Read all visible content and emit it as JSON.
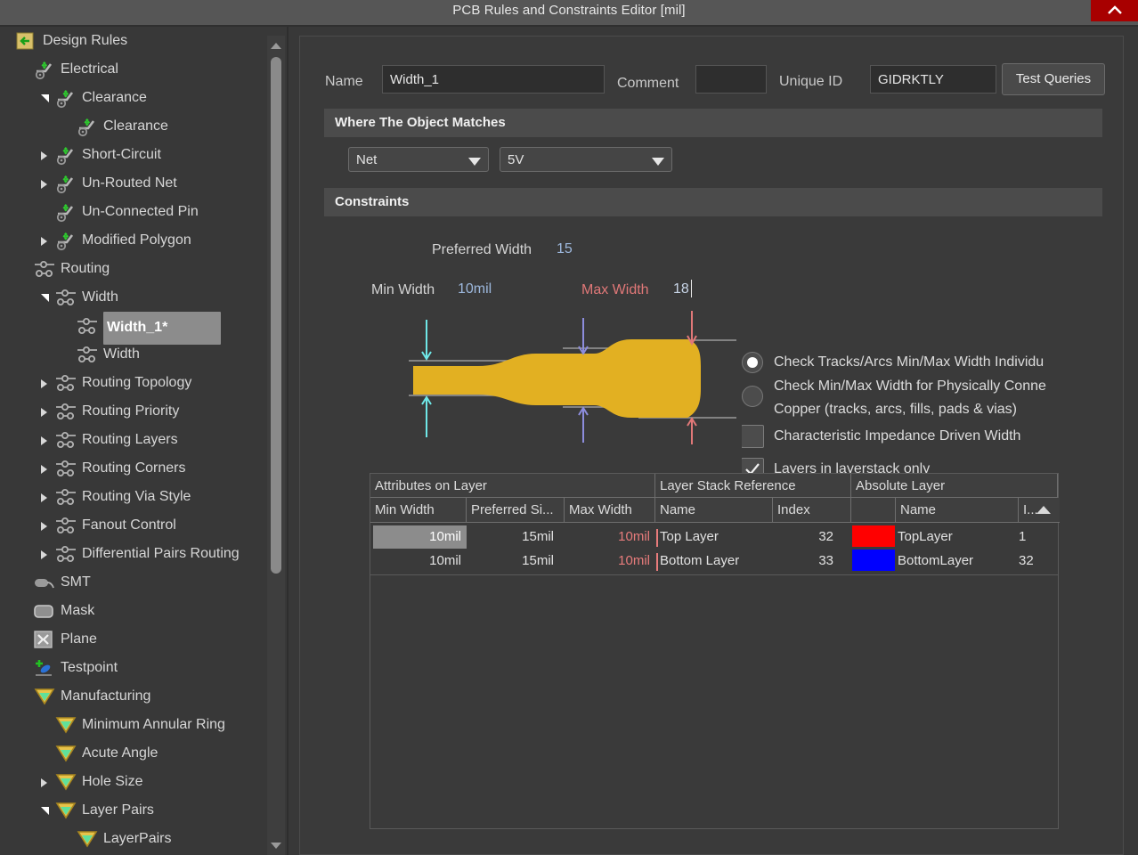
{
  "window": {
    "title": "PCB Rules and Constraints Editor [mil]",
    "close_icon": "close-icon",
    "close_color": "#a80000"
  },
  "sidebar": {
    "scrollbar": {
      "up_icon": "scroll-up-arrow-icon",
      "down_icon": "scroll-down-arrow-icon"
    },
    "items": [
      {
        "label": "Design Rules",
        "depth": 0,
        "icon": "design-rules-icon",
        "twisty": "none",
        "selected": false
      },
      {
        "label": "Electrical",
        "depth": 1,
        "icon": "electrical-icon",
        "twisty": "none",
        "selected": false
      },
      {
        "label": "Clearance",
        "depth": 2,
        "icon": "electrical-icon",
        "twisty": "down",
        "selected": false
      },
      {
        "label": "Clearance",
        "depth": 3,
        "icon": "electrical-icon",
        "twisty": "none",
        "selected": false
      },
      {
        "label": "Short-Circuit",
        "depth": 2,
        "icon": "electrical-icon",
        "twisty": "right",
        "selected": false
      },
      {
        "label": "Un-Routed Net",
        "depth": 2,
        "icon": "electrical-icon",
        "twisty": "right",
        "selected": false
      },
      {
        "label": "Un-Connected Pin",
        "depth": 2,
        "icon": "electrical-icon",
        "twisty": "none",
        "selected": false
      },
      {
        "label": "Modified Polygon",
        "depth": 2,
        "icon": "electrical-icon",
        "twisty": "right",
        "selected": false
      },
      {
        "label": "Routing",
        "depth": 1,
        "icon": "routing-icon",
        "twisty": "none",
        "selected": false
      },
      {
        "label": "Width",
        "depth": 2,
        "icon": "routing-icon",
        "twisty": "down",
        "selected": false
      },
      {
        "label": "Width_1*",
        "depth": 3,
        "icon": "routing-icon",
        "twisty": "none",
        "selected": true
      },
      {
        "label": "Width",
        "depth": 3,
        "icon": "routing-icon",
        "twisty": "none",
        "selected": false
      },
      {
        "label": "Routing Topology",
        "depth": 2,
        "icon": "routing-icon",
        "twisty": "right",
        "selected": false
      },
      {
        "label": "Routing Priority",
        "depth": 2,
        "icon": "routing-icon",
        "twisty": "right",
        "selected": false
      },
      {
        "label": "Routing Layers",
        "depth": 2,
        "icon": "routing-icon",
        "twisty": "right",
        "selected": false
      },
      {
        "label": "Routing Corners",
        "depth": 2,
        "icon": "routing-icon",
        "twisty": "right",
        "selected": false
      },
      {
        "label": "Routing Via Style",
        "depth": 2,
        "icon": "routing-icon",
        "twisty": "right",
        "selected": false
      },
      {
        "label": "Fanout Control",
        "depth": 2,
        "icon": "routing-icon",
        "twisty": "right",
        "selected": false
      },
      {
        "label": "Differential Pairs Routing",
        "depth": 2,
        "icon": "routing-icon",
        "twisty": "right",
        "selected": false
      },
      {
        "label": "SMT",
        "depth": 1,
        "icon": "smt-icon",
        "twisty": "none",
        "selected": false
      },
      {
        "label": "Mask",
        "depth": 1,
        "icon": "mask-icon",
        "twisty": "none",
        "selected": false
      },
      {
        "label": "Plane",
        "depth": 1,
        "icon": "plane-icon",
        "twisty": "none",
        "selected": false
      },
      {
        "label": "Testpoint",
        "depth": 1,
        "icon": "testpoint-icon",
        "twisty": "none",
        "selected": false
      },
      {
        "label": "Manufacturing",
        "depth": 1,
        "icon": "manufacturing-icon",
        "twisty": "none",
        "selected": false
      },
      {
        "label": "Minimum Annular Ring",
        "depth": 2,
        "icon": "manufacturing-icon",
        "twisty": "none",
        "selected": false
      },
      {
        "label": "Acute Angle",
        "depth": 2,
        "icon": "manufacturing-icon",
        "twisty": "none",
        "selected": false
      },
      {
        "label": "Hole Size",
        "depth": 2,
        "icon": "manufacturing-icon",
        "twisty": "right",
        "selected": false
      },
      {
        "label": "Layer Pairs",
        "depth": 2,
        "icon": "manufacturing-icon",
        "twisty": "down",
        "selected": false
      },
      {
        "label": "LayerPairs",
        "depth": 3,
        "icon": "manufacturing-icon",
        "twisty": "none",
        "selected": false
      }
    ]
  },
  "form": {
    "name_label": "Name",
    "name_value": "Width_1",
    "comment_label": "Comment",
    "comment_value": "",
    "comment_placeholder": "",
    "unique_id_label": "Unique ID",
    "unique_id_value": "GIDRKTLY",
    "test_queries_label": "Test Queries"
  },
  "where_section": {
    "title": "Where The Object Matches",
    "scope_combo": {
      "value": "Net",
      "caret_icon": "chevron-down-icon"
    },
    "net_combo": {
      "value": "5V",
      "caret_icon": "chevron-down-icon"
    }
  },
  "constraints_section": {
    "title": "Constraints",
    "diagram": {
      "preferred_label": "Preferred Width",
      "preferred_value": "15",
      "min_label": "Min Width",
      "min_value": "10mil",
      "max_label": "Max Width",
      "max_value": "18",
      "track_color": "#e2b022",
      "min_arrow_color": "#6fe8e8",
      "pref_arrow_color": "#8d8ddd",
      "max_arrow_color": "#e07878",
      "max_label_color": "#e07878",
      "min_value_color": "#9db8dd",
      "pref_value_color": "#9db8dd"
    },
    "options": [
      {
        "type": "radio",
        "label": "Check Tracks/Arcs Min/Max Width Individu",
        "checked": true
      },
      {
        "type": "radio",
        "label": "Check Min/Max Width for Physically Conne",
        "label2": "Copper (tracks, arcs, fills, pads & vias)",
        "checked": false
      },
      {
        "type": "checkbox",
        "label": "Characteristic Impedance Driven Width",
        "checked": false
      },
      {
        "type": "checkbox",
        "label": "Layers in layerstack only",
        "checked": true
      }
    ]
  },
  "table": {
    "group_headers": [
      {
        "label": "Attributes on Layer"
      },
      {
        "label": "Layer Stack Reference"
      },
      {
        "label": "Absolute Layer"
      }
    ],
    "columns": [
      {
        "label": "Min Width"
      },
      {
        "label": "Preferred Si..."
      },
      {
        "label": "Max Width"
      },
      {
        "label": "Name"
      },
      {
        "label": "Index"
      },
      {
        "label": ""
      },
      {
        "label": "Name"
      },
      {
        "label": "I...",
        "sort": "asc",
        "sort_icon": "sort-ascending-icon"
      }
    ],
    "rows": [
      {
        "min_width": "10mil",
        "preferred_size": "15mil",
        "max_width": "10mil",
        "stack_name": "Top Layer",
        "stack_index": "32",
        "color": "#ff0000",
        "abs_name": "TopLayer",
        "abs_index": "1",
        "selected_cell": true
      },
      {
        "min_width": "10mil",
        "preferred_size": "15mil",
        "max_width": "10mil",
        "stack_name": "Bottom Layer",
        "stack_index": "33",
        "color": "#0000ff",
        "abs_name": "BottomLayer",
        "abs_index": "32",
        "selected_cell": false
      }
    ]
  }
}
